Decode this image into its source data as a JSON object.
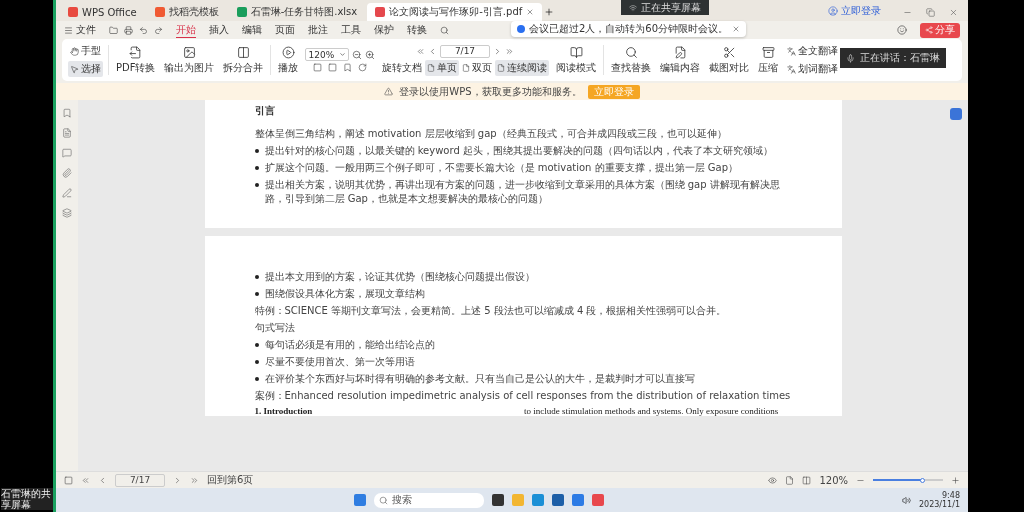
{
  "title_bar": {
    "tabs": [
      {
        "label": "WPS Office",
        "kind": "home",
        "selected": false
      },
      {
        "label": "找稻壳模板",
        "kind": "template",
        "selected": false
      },
      {
        "label": "石雷琳-任务甘特图.xlsx",
        "kind": "sheet",
        "selected": false
      },
      {
        "label": "论文阅读与写作琢卯-引言.pdf",
        "kind": "pdf",
        "selected": true
      }
    ],
    "login": "立即登录"
  },
  "screen_share": {
    "label": "正在共享屏幕",
    "notice": "会议已超过2人，自动转为60分钟限时会议。"
  },
  "menu": {
    "file": "文件",
    "items": [
      {
        "label": "开始",
        "selected": true
      },
      {
        "label": "插入",
        "selected": false
      },
      {
        "label": "编辑",
        "selected": false
      },
      {
        "label": "页面",
        "selected": false
      },
      {
        "label": "批注",
        "selected": false
      },
      {
        "label": "工具",
        "selected": false
      },
      {
        "label": "保护",
        "selected": false
      },
      {
        "label": "转换",
        "selected": false
      }
    ],
    "share": "分享"
  },
  "toolbar": {
    "modes": [
      {
        "label": "手型",
        "selected": false
      },
      {
        "label": "选择",
        "selected": true
      }
    ],
    "convert": [
      "PDF转换",
      "输出为图片",
      "拆分合并"
    ],
    "play": "播放",
    "zoom": "120%",
    "page": "7/17",
    "rotate": "旋转文档",
    "views": [
      {
        "label": "单页",
        "selected": true
      },
      {
        "label": "双页",
        "selected": false
      },
      {
        "label": "连续阅读",
        "selected": true
      }
    ],
    "reading_mode": "阅读模式",
    "tools": [
      "查找替换",
      "编辑内容",
      "截图对比",
      "压缩"
    ],
    "translate": [
      "全文翻译",
      "划词翻译"
    ]
  },
  "speaking": {
    "label": "正在讲话：石雷琳"
  },
  "notice": {
    "text": "登录以使用WPS，获取更多功能和服务。",
    "button": "立即登录"
  },
  "document": {
    "pages": [
      {
        "blocks": [
          {
            "kind": "heading",
            "text": "引言"
          },
          {
            "kind": "para",
            "text": "整体呈倒三角结构，阐述 motivation 层层收缩到 gap（经典五段式，可合并成四段或三段，也可以延伸）"
          },
          {
            "kind": "bullet",
            "text": "提出针对的核心问题，以最关键的 keyword 起头，围绕其提出要解决的问题（四句话以内，代表了本文研究领域）"
          },
          {
            "kind": "bullet",
            "text": "扩展这个问题。一般用两三个例子即可，不需要长篇大论（是 motivation 的重要支撑，提出第一层 Gap）"
          },
          {
            "kind": "bullet",
            "text": "提出相关方案，说明其优势，再讲出现有方案的问题，进一步收缩到文章采用的具体方案（围绕 gap 讲解现有解决思路，引导到第二层 Gap，也就是本文想要解决的最核心的问题）"
          }
        ]
      },
      {
        "blocks": [
          {
            "kind": "bullet",
            "text": "提出本文用到的方案，论证其优势（围绕核心问题提出假设）"
          },
          {
            "kind": "bullet",
            "text": "围绕假设具体化方案，展现文章结构"
          },
          {
            "kind": "para",
            "text": "特例：SCIENCE 等期刊文章写法，会更精简。上述 5 段法也可以缩减成 4 段，根据相关性强弱可以合并。"
          },
          {
            "kind": "para",
            "text": "句式写法"
          },
          {
            "kind": "bullet",
            "text": "每句话必须是有用的，能给出结论点的"
          },
          {
            "kind": "bullet",
            "text": "尽量不要使用首次、第一次等用语"
          },
          {
            "kind": "bullet",
            "text": "在评价某个东西好与坏时得有明确的参考文献。只有当自己是公认的大牛，是裁判时才可以直接写"
          },
          {
            "kind": "para",
            "text": "案例：Enhanced resolution impedimetric analysis of cell responses from the distribution of relaxation times"
          },
          {
            "kind": "columns",
            "left": "1.  Introduction",
            "right": "to include stimulation methods and systems. Only exposure conditions"
          }
        ]
      }
    ]
  },
  "status_bar": {
    "page": "7/17",
    "back": "回到第6页",
    "zoom": "120%",
    "zoom_slider": {
      "level": 0.72
    }
  },
  "taskbar": {
    "search": "搜索",
    "time": "9:48",
    "date": "2023/11/1"
  },
  "share_caption": "石雷琳的共享屏幕"
}
